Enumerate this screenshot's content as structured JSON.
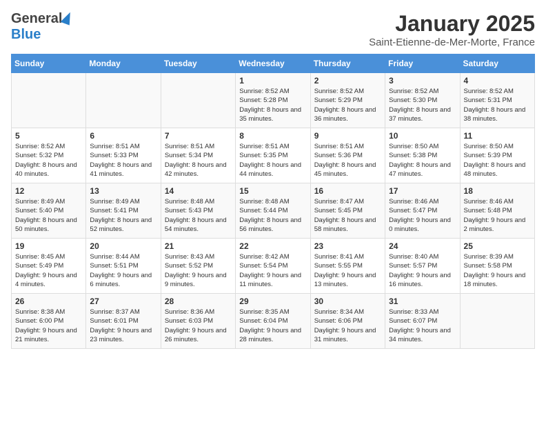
{
  "header": {
    "logo_general": "General",
    "logo_blue": "Blue",
    "month_title": "January 2025",
    "location": "Saint-Etienne-de-Mer-Morte, France"
  },
  "weekdays": [
    "Sunday",
    "Monday",
    "Tuesday",
    "Wednesday",
    "Thursday",
    "Friday",
    "Saturday"
  ],
  "weeks": [
    [
      {
        "day": "",
        "info": ""
      },
      {
        "day": "",
        "info": ""
      },
      {
        "day": "",
        "info": ""
      },
      {
        "day": "1",
        "info": "Sunrise: 8:52 AM\nSunset: 5:28 PM\nDaylight: 8 hours and 35 minutes."
      },
      {
        "day": "2",
        "info": "Sunrise: 8:52 AM\nSunset: 5:29 PM\nDaylight: 8 hours and 36 minutes."
      },
      {
        "day": "3",
        "info": "Sunrise: 8:52 AM\nSunset: 5:30 PM\nDaylight: 8 hours and 37 minutes."
      },
      {
        "day": "4",
        "info": "Sunrise: 8:52 AM\nSunset: 5:31 PM\nDaylight: 8 hours and 38 minutes."
      }
    ],
    [
      {
        "day": "5",
        "info": "Sunrise: 8:52 AM\nSunset: 5:32 PM\nDaylight: 8 hours and 40 minutes."
      },
      {
        "day": "6",
        "info": "Sunrise: 8:51 AM\nSunset: 5:33 PM\nDaylight: 8 hours and 41 minutes."
      },
      {
        "day": "7",
        "info": "Sunrise: 8:51 AM\nSunset: 5:34 PM\nDaylight: 8 hours and 42 minutes."
      },
      {
        "day": "8",
        "info": "Sunrise: 8:51 AM\nSunset: 5:35 PM\nDaylight: 8 hours and 44 minutes."
      },
      {
        "day": "9",
        "info": "Sunrise: 8:51 AM\nSunset: 5:36 PM\nDaylight: 8 hours and 45 minutes."
      },
      {
        "day": "10",
        "info": "Sunrise: 8:50 AM\nSunset: 5:38 PM\nDaylight: 8 hours and 47 minutes."
      },
      {
        "day": "11",
        "info": "Sunrise: 8:50 AM\nSunset: 5:39 PM\nDaylight: 8 hours and 48 minutes."
      }
    ],
    [
      {
        "day": "12",
        "info": "Sunrise: 8:49 AM\nSunset: 5:40 PM\nDaylight: 8 hours and 50 minutes."
      },
      {
        "day": "13",
        "info": "Sunrise: 8:49 AM\nSunset: 5:41 PM\nDaylight: 8 hours and 52 minutes."
      },
      {
        "day": "14",
        "info": "Sunrise: 8:48 AM\nSunset: 5:43 PM\nDaylight: 8 hours and 54 minutes."
      },
      {
        "day": "15",
        "info": "Sunrise: 8:48 AM\nSunset: 5:44 PM\nDaylight: 8 hours and 56 minutes."
      },
      {
        "day": "16",
        "info": "Sunrise: 8:47 AM\nSunset: 5:45 PM\nDaylight: 8 hours and 58 minutes."
      },
      {
        "day": "17",
        "info": "Sunrise: 8:46 AM\nSunset: 5:47 PM\nDaylight: 9 hours and 0 minutes."
      },
      {
        "day": "18",
        "info": "Sunrise: 8:46 AM\nSunset: 5:48 PM\nDaylight: 9 hours and 2 minutes."
      }
    ],
    [
      {
        "day": "19",
        "info": "Sunrise: 8:45 AM\nSunset: 5:49 PM\nDaylight: 9 hours and 4 minutes."
      },
      {
        "day": "20",
        "info": "Sunrise: 8:44 AM\nSunset: 5:51 PM\nDaylight: 9 hours and 6 minutes."
      },
      {
        "day": "21",
        "info": "Sunrise: 8:43 AM\nSunset: 5:52 PM\nDaylight: 9 hours and 9 minutes."
      },
      {
        "day": "22",
        "info": "Sunrise: 8:42 AM\nSunset: 5:54 PM\nDaylight: 9 hours and 11 minutes."
      },
      {
        "day": "23",
        "info": "Sunrise: 8:41 AM\nSunset: 5:55 PM\nDaylight: 9 hours and 13 minutes."
      },
      {
        "day": "24",
        "info": "Sunrise: 8:40 AM\nSunset: 5:57 PM\nDaylight: 9 hours and 16 minutes."
      },
      {
        "day": "25",
        "info": "Sunrise: 8:39 AM\nSunset: 5:58 PM\nDaylight: 9 hours and 18 minutes."
      }
    ],
    [
      {
        "day": "26",
        "info": "Sunrise: 8:38 AM\nSunset: 6:00 PM\nDaylight: 9 hours and 21 minutes."
      },
      {
        "day": "27",
        "info": "Sunrise: 8:37 AM\nSunset: 6:01 PM\nDaylight: 9 hours and 23 minutes."
      },
      {
        "day": "28",
        "info": "Sunrise: 8:36 AM\nSunset: 6:03 PM\nDaylight: 9 hours and 26 minutes."
      },
      {
        "day": "29",
        "info": "Sunrise: 8:35 AM\nSunset: 6:04 PM\nDaylight: 9 hours and 28 minutes."
      },
      {
        "day": "30",
        "info": "Sunrise: 8:34 AM\nSunset: 6:06 PM\nDaylight: 9 hours and 31 minutes."
      },
      {
        "day": "31",
        "info": "Sunrise: 8:33 AM\nSunset: 6:07 PM\nDaylight: 9 hours and 34 minutes."
      },
      {
        "day": "",
        "info": ""
      }
    ]
  ]
}
